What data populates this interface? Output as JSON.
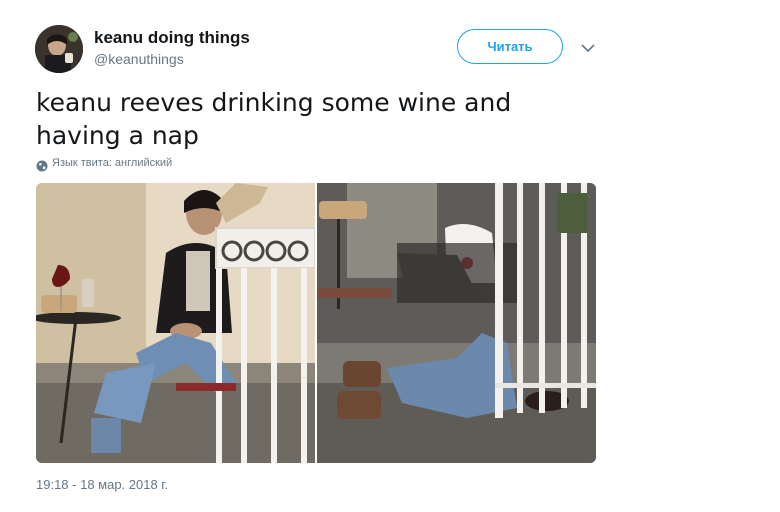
{
  "tweet": {
    "author": {
      "display_name": "keanu doing things",
      "handle": "@keanuthings"
    },
    "follow_label": "Читать",
    "text": "keanu reeves drinking some wine and having a nap",
    "language_note": "Язык твита: английский",
    "timestamp": "19:18 - 18 мар. 2018 г.",
    "media": {
      "photos": [
        "photo-left",
        "photo-right"
      ]
    }
  },
  "colors": {
    "accent": "#1da1f2",
    "secondary_text": "#657786",
    "primary_text": "#14171a"
  },
  "icons": {
    "caret": "chevron-down-icon",
    "globe": "globe-icon"
  }
}
